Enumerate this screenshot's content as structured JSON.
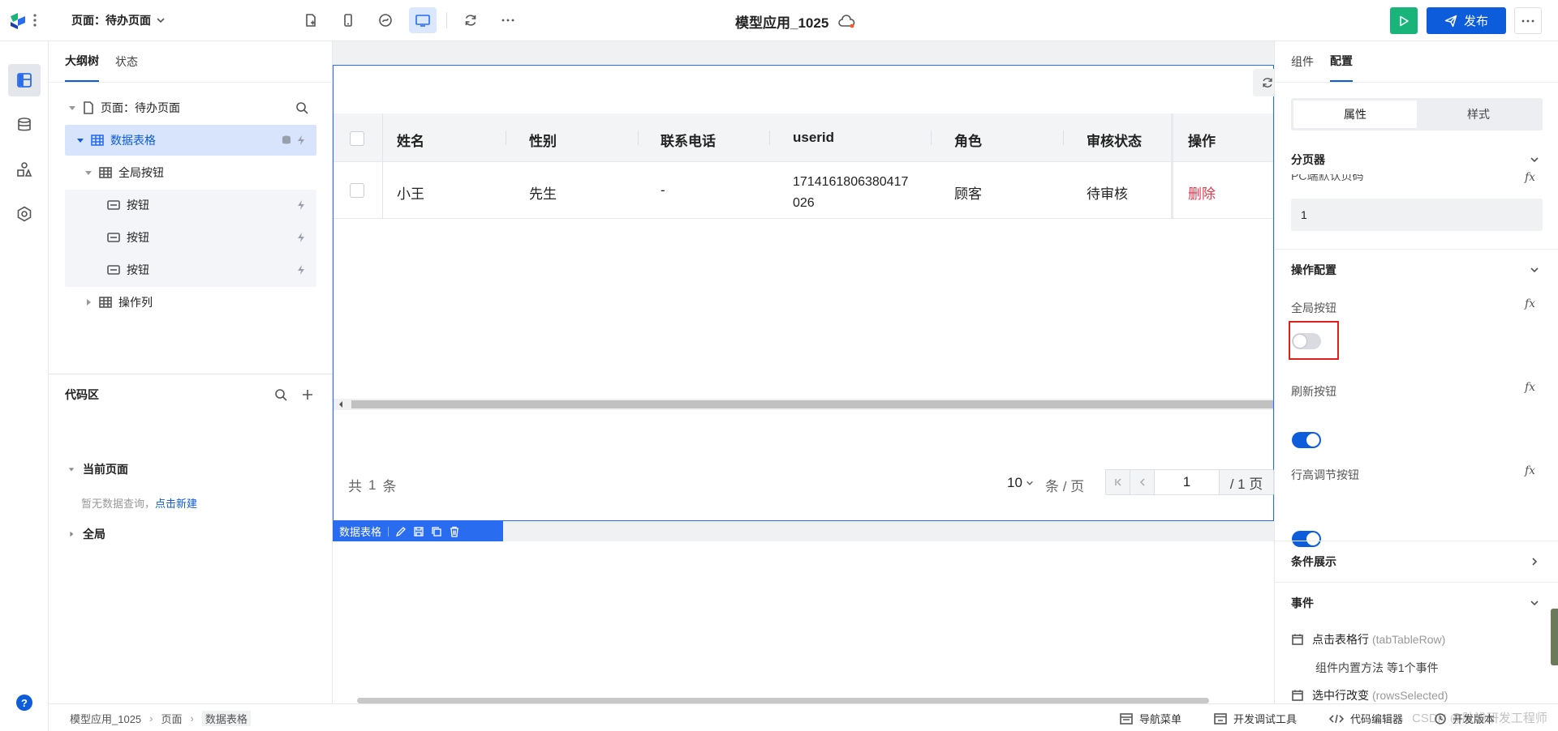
{
  "header": {
    "page_selector": "页面：待办页面",
    "app_title": "模型应用_1025",
    "publish_label": "发布"
  },
  "left": {
    "tabs": [
      "大纲树",
      "状态"
    ],
    "tree": {
      "page": "页面：待办页面",
      "table": "数据表格",
      "global_buttons": "全局按钮",
      "button1": "按钮",
      "button2": "按钮",
      "button3": "按钮",
      "action_column": "操作列"
    },
    "code": {
      "title": "代码区",
      "current_page": "当前页面",
      "empty_text": "暂无数据查询，",
      "create_link": "点击新建",
      "global": "全局"
    }
  },
  "table": {
    "columns": [
      "姓名",
      "性别",
      "联系电话",
      "userid",
      "角色",
      "审核状态",
      "操作"
    ],
    "rows": [
      {
        "name": "小王",
        "gender": "先生",
        "phone": "-",
        "userid_line1": "1714161806380417",
        "userid_line2": "026",
        "role": "顾客",
        "status": "待审核",
        "action": "删除"
      }
    ],
    "pagination": {
      "total_prefix": "共",
      "total": "1",
      "total_suffix": "条",
      "page_size": "10",
      "per_page": "条 / 页",
      "current": "1",
      "pages": "/ 1 页"
    },
    "selection_label": "数据表格"
  },
  "right": {
    "tabs": [
      "组件",
      "配置"
    ],
    "subtabs": [
      "属性",
      "样式"
    ],
    "pager": {
      "title": "分页器",
      "field_label": "PC端默认页码",
      "field_value": "1"
    },
    "ops": {
      "title": "操作配置",
      "global_button": "全局按钮",
      "global_on": false,
      "refresh_button": "刷新按钮",
      "refresh_on": true,
      "rowheight_button": "行高调节按钮",
      "rowheight_on": true
    },
    "fx": "fx",
    "conditional": "条件展示",
    "events": {
      "title": "事件",
      "e1": "点击表格行",
      "e1_code": "(tabTableRow)",
      "e1_desc": "组件内置方法 等1个事件",
      "e2": "选中行改变",
      "e2_code": "(rowsSelected)"
    }
  },
  "status": {
    "breadcrumb": [
      "模型应用_1025",
      "页面",
      "数据表格"
    ],
    "nav_menu": "导航菜单",
    "dev_tools": "开发调试工具",
    "code_editor": "代码编辑器",
    "dev_version": "开发版本",
    "watermark": "CSDN @肤浅研发工程师"
  },
  "colors": {
    "brand_blue": "#0d5cdb",
    "run_green": "#19b47a",
    "danger": "#e6394a",
    "highlight_red": "#e02020"
  }
}
